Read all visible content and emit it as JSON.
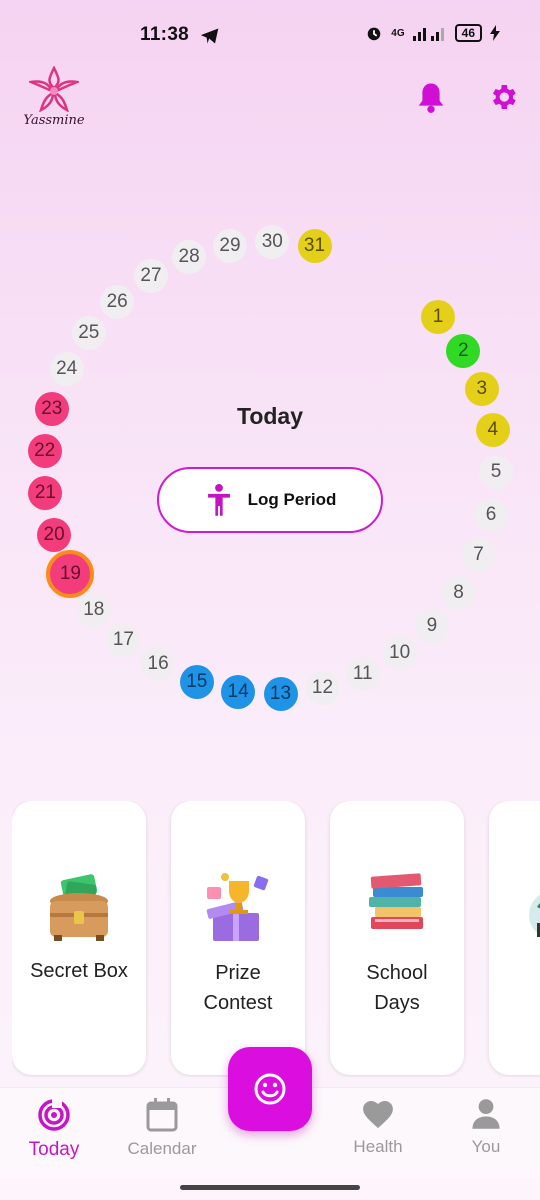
{
  "status_bar": {
    "time": "11:38",
    "network": "4G",
    "battery": "46"
  },
  "app": {
    "logo_text": "Yassmine"
  },
  "header": {
    "bell_icon": "bell-icon",
    "settings_icon": "gear-icon"
  },
  "cycle": {
    "center_label": "Today",
    "log_button_label": "Log Period",
    "today_day": 19,
    "days": [
      {
        "n": "1",
        "type": "pms"
      },
      {
        "n": "2",
        "type": "ovulation"
      },
      {
        "n": "3",
        "type": "pms"
      },
      {
        "n": "4",
        "type": "pms"
      },
      {
        "n": "5",
        "type": "normal"
      },
      {
        "n": "6",
        "type": "normal"
      },
      {
        "n": "7",
        "type": "normal"
      },
      {
        "n": "8",
        "type": "normal"
      },
      {
        "n": "9",
        "type": "normal"
      },
      {
        "n": "10",
        "type": "normal"
      },
      {
        "n": "11",
        "type": "normal"
      },
      {
        "n": "12",
        "type": "normal"
      },
      {
        "n": "13",
        "type": "fertile"
      },
      {
        "n": "14",
        "type": "fertile"
      },
      {
        "n": "15",
        "type": "fertile"
      },
      {
        "n": "16",
        "type": "normal"
      },
      {
        "n": "17",
        "type": "normal"
      },
      {
        "n": "18",
        "type": "normal"
      },
      {
        "n": "19",
        "type": "period"
      },
      {
        "n": "20",
        "type": "period"
      },
      {
        "n": "21",
        "type": "period"
      },
      {
        "n": "22",
        "type": "period"
      },
      {
        "n": "23",
        "type": "period"
      },
      {
        "n": "24",
        "type": "normal"
      },
      {
        "n": "25",
        "type": "normal"
      },
      {
        "n": "26",
        "type": "normal"
      },
      {
        "n": "27",
        "type": "normal"
      },
      {
        "n": "28",
        "type": "normal"
      },
      {
        "n": "29",
        "type": "normal"
      },
      {
        "n": "30",
        "type": "normal"
      },
      {
        "n": "31",
        "type": "pms"
      }
    ],
    "colors": {
      "period": "#f23c7b",
      "fertile": "#1f93e6",
      "ovulation": "#2fd924",
      "pms": "#e4cf19",
      "today_ring": "#fb8c1c"
    }
  },
  "cards": [
    {
      "title": "Secret Box",
      "icon": "treasure-chest-icon"
    },
    {
      "title": "Prize\nContest",
      "icon": "trophy-gift-icon"
    },
    {
      "title": "School\nDays",
      "icon": "books-icon"
    }
  ],
  "fab": {
    "icon": "smiley-icon"
  },
  "bottom_nav": {
    "items": [
      {
        "label": "Today",
        "icon": "today-target-icon",
        "active": true
      },
      {
        "label": "Calendar",
        "icon": "calendar-icon",
        "active": false
      },
      {
        "label": "Health",
        "icon": "heart-icon",
        "active": false
      },
      {
        "label": "You",
        "icon": "person-icon",
        "active": false
      }
    ]
  },
  "accent_color": "#d81ad8"
}
